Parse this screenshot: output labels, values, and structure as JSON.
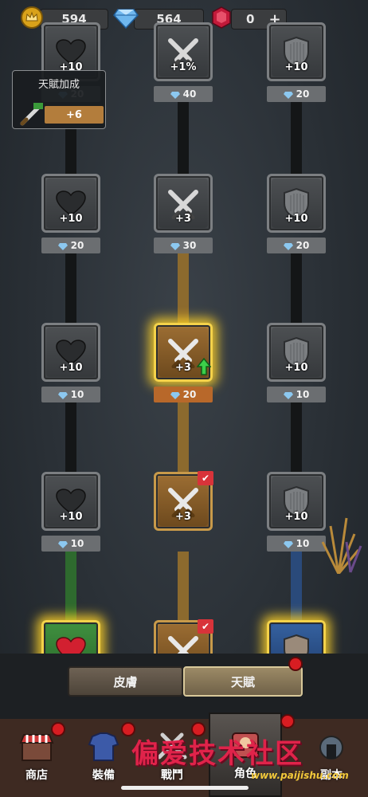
{
  "currencies": {
    "crown": "594",
    "diamond": "564",
    "ruby": "0",
    "ruby_add": "+"
  },
  "bonus_card": {
    "title": "天賦加成",
    "value": "+6"
  },
  "rows": [
    {
      "left": {
        "val": "+10",
        "cost": "20"
      },
      "mid": {
        "val": "+1%",
        "cost": "40"
      },
      "right": {
        "val": "+10",
        "cost": "20"
      }
    },
    {
      "left": {
        "val": "+10",
        "cost": "20"
      },
      "mid": {
        "val": "+3",
        "cost": "30"
      },
      "right": {
        "val": "+10",
        "cost": "20"
      }
    },
    {
      "left": {
        "val": "+10",
        "cost": "10"
      },
      "mid": {
        "val": "+3",
        "cost": "20"
      },
      "right": {
        "val": "+10",
        "cost": "10"
      }
    },
    {
      "left": {
        "val": "+10",
        "cost": "10"
      },
      "mid": {
        "val": "+3",
        "cost": ""
      },
      "right": {
        "val": "+10",
        "cost": "10"
      }
    }
  ],
  "tabs": {
    "skin": "皮膚",
    "talent": "天賦"
  },
  "nav": {
    "shop": "商店",
    "equip": "裝備",
    "battle": "戰鬥",
    "role": "角色",
    "extra": "副本"
  },
  "watermark": {
    "text": "偏爱技术社区",
    "url": "www.paijishu.com"
  },
  "colors": {
    "gold": "#f4d24a",
    "tile": "#4c4f52",
    "accent_red": "#d81d22"
  }
}
